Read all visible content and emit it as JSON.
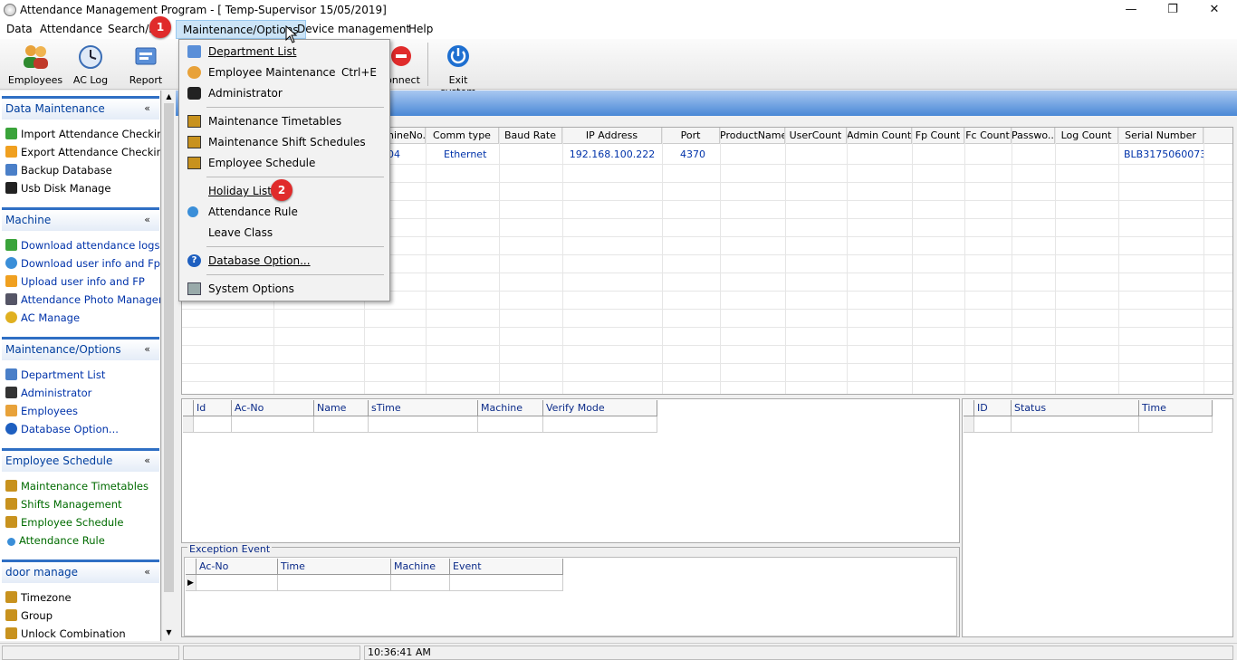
{
  "window": {
    "title": "Attendance Management Program - [ Temp-Supervisor 15/05/2019]",
    "min": "—",
    "max": "❐",
    "close": "✕"
  },
  "menu": {
    "items": [
      "Data",
      "Attendance",
      "Search/P",
      "Maintenance/Options",
      "Device management",
      "Help"
    ]
  },
  "toolbar": {
    "employees": "Employees",
    "aclog": "AC Log",
    "report": "Report",
    "connect": "onnect",
    "exit": "Exit system"
  },
  "dropdown": {
    "items": [
      {
        "label": "Department List",
        "shortcut": ""
      },
      {
        "label": "Employee Maintenance",
        "shortcut": "Ctrl+E"
      },
      {
        "label": "Administrator",
        "shortcut": ""
      },
      {
        "label": "Maintenance Timetables",
        "shortcut": ""
      },
      {
        "label": "Maintenance Shift Schedules",
        "shortcut": ""
      },
      {
        "label": "Employee Schedule",
        "shortcut": ""
      },
      {
        "label": "Holiday List",
        "shortcut": ""
      },
      {
        "label": "Attendance Rule",
        "shortcut": ""
      },
      {
        "label": "Leave Class",
        "shortcut": ""
      },
      {
        "label": "Database Option...",
        "shortcut": ""
      },
      {
        "label": "System Options",
        "shortcut": ""
      }
    ]
  },
  "badges": [
    "1",
    "2"
  ],
  "sidebar": {
    "sections": [
      {
        "title": "Data Maintenance",
        "items": [
          "Import Attendance Checking ...",
          "Export Attendance Checking ...",
          "Backup Database",
          "Usb Disk Manage"
        ]
      },
      {
        "title": "Machine",
        "items": [
          "Download attendance logs",
          "Download user info and Fp",
          "Upload user info and FP",
          "Attendance Photo Managem...",
          "AC Manage"
        ]
      },
      {
        "title": "Maintenance/Options",
        "items": [
          "Department List",
          "Administrator",
          "Employees",
          "Database Option..."
        ]
      },
      {
        "title": "Employee Schedule",
        "items": [
          "Maintenance Timetables",
          "Shifts Management",
          "Employee Schedule",
          "Attendance Rule"
        ]
      },
      {
        "title": "door manage",
        "items": [
          "Timezone",
          "Group",
          "Unlock Combination"
        ]
      }
    ],
    "chevron": "«"
  },
  "device_grid": {
    "headers": [
      "hineNo.",
      "Comm type",
      "Baud Rate",
      "IP Address",
      "Port",
      "ProductName",
      "UserCount",
      "Admin Count",
      "Fp Count",
      "Fc Count",
      "Passwo...",
      "Log Count",
      "Serial Number"
    ],
    "row": [
      "04",
      "Ethernet",
      "",
      "192.168.100.222",
      "4370",
      "",
      "",
      "",
      "",
      "",
      "",
      "",
      "BLB3175060073"
    ]
  },
  "log_table": {
    "headers": [
      "Id",
      "Ac-No",
      "Name",
      "sTime",
      "Machine",
      "Verify Mode"
    ]
  },
  "status_table": {
    "headers": [
      "ID",
      "Status",
      "Time"
    ]
  },
  "exception": {
    "title": "Exception Event",
    "headers": [
      "Ac-No",
      "Time",
      "Machine",
      "Event"
    ],
    "row_marker": "▶"
  },
  "status": {
    "time": "10:36:41 AM"
  }
}
